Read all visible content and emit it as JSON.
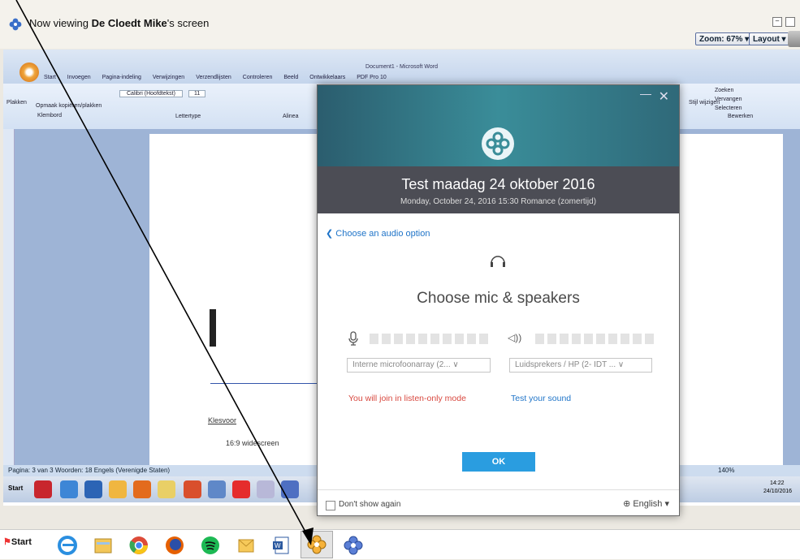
{
  "viewer": {
    "title_prefix": "Now viewing ",
    "presenter": "De Cloedt Mike",
    "title_suffix": "'s screen",
    "zoom_label": "Zoom: 67% ▾",
    "layout_label": "Layout ▾"
  },
  "word": {
    "doc_title": "Document1 - Microsoft Word",
    "tabs": [
      "Start",
      "Invoegen",
      "Pagina-indeling",
      "Verwijzingen",
      "Verzendlijsten",
      "Controleren",
      "Beeld",
      "Ontwikkelaars",
      "PDF Pro 10"
    ],
    "font_name": "Calibri (Hoofdtekst)",
    "font_size": "11",
    "groups": [
      "Klembord",
      "Lettertype",
      "Alinea",
      "Bewerken"
    ],
    "paste_label": "Plakken",
    "format_painter": "Opmaak kopiëren/plakken",
    "edit_items": [
      "Zoeken",
      "Vervangen",
      "Selecteren"
    ],
    "style_label": "Stijl wijzigen",
    "doc_lines": [
      "Klesvoor",
      "16:9 widescreen"
    ],
    "status_text": "Pagina: 3 van 3   Woorden: 18   Engels (Verenigde Staten)",
    "zoom_status": "140%",
    "clock_time": "14:22",
    "clock_date": "24/10/2016",
    "start_label": "Start"
  },
  "dialog": {
    "title": "Test maadag 24 oktober 2016",
    "subtitle": "Monday, October 24, 2016   15:30 Romance (zomertijd)",
    "back_label": "Choose an audio option",
    "heading": "Choose mic & speakers",
    "mic_select": "Interne microfoonarray (2...  ∨",
    "speaker_select": "Luidsprekers / HP (2- IDT ...  ∨",
    "listen_only": "You will join in listen-only mode",
    "test_sound": "Test your sound",
    "ok_label": "OK",
    "dont_show": "Don't show again",
    "language": "English",
    "colors": {
      "accent": "#2a9de0",
      "warning": "#d8483f",
      "link": "#1f74c8"
    }
  },
  "taskbar": {
    "start_label": "Start",
    "icons": [
      "ie-icon",
      "explorer-icon",
      "chrome-icon",
      "firefox-icon",
      "spotify-icon",
      "outlook-icon",
      "word-icon",
      "webex-active-icon",
      "webex-icon"
    ]
  }
}
